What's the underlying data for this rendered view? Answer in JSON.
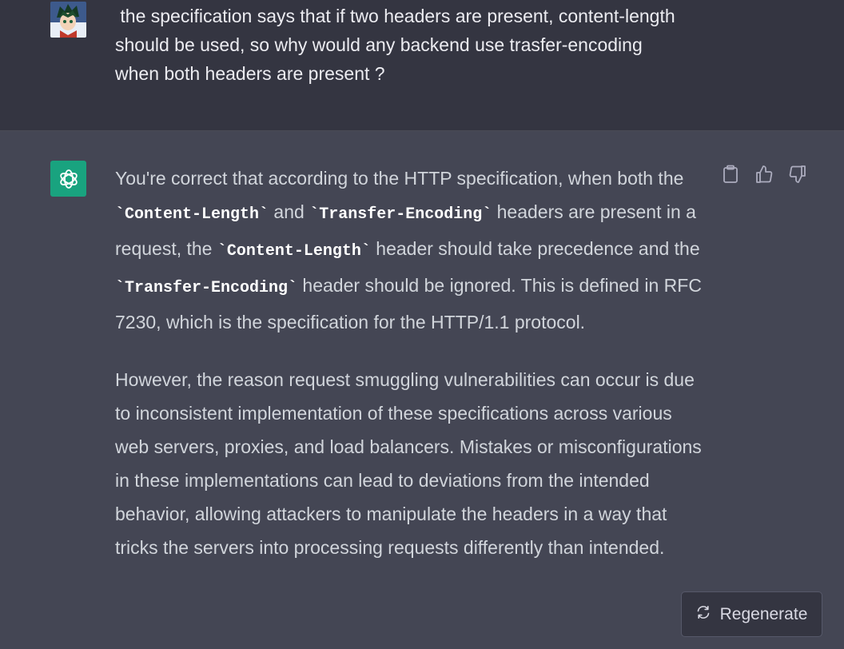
{
  "user_message": {
    "text": " the specification says that if two headers are present, content-length\nshould be used, so why would any backend use trasfer-encoding\nwhen both headers are present ?"
  },
  "assistant_message": {
    "p1": {
      "t1": "You're correct that according to the HTTP specification, when both the ",
      "c1": "`Content-Length`",
      "t2": " and ",
      "c2": "`Transfer-Encoding`",
      "t3": " headers are present in a request, the ",
      "c3": "`Content-Length`",
      "t4": " header should take precedence and the ",
      "c4": "`Transfer-Encoding`",
      "t5": " header should be ignored. This is defined in RFC 7230, which is the specification for the HTTP/1.1 protocol."
    },
    "p2": "However, the reason request smuggling vulnerabilities can occur is due to inconsistent implementation of these specifications across various web servers, proxies, and load balancers. Mistakes or misconfigurations in these implementations can lead to deviations from the intended behavior, allowing attackers to manipulate the headers in a way that tricks the servers into processing requests differently than intended."
  },
  "actions": {
    "icons": [
      "clipboard-icon",
      "thumbs-up-icon",
      "thumbs-down-icon"
    ]
  },
  "regenerate_button": {
    "label": "Regenerate",
    "icon": "refresh-icon"
  },
  "colors": {
    "background": "#343541",
    "assistant_background": "#444654",
    "bot_avatar": "#19a37f"
  }
}
